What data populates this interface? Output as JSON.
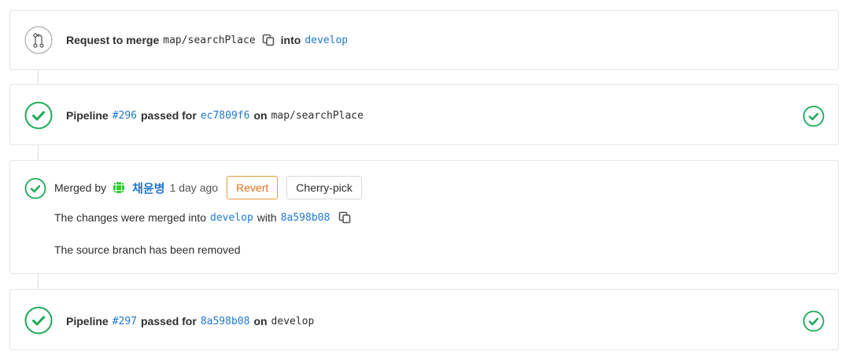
{
  "request_card": {
    "prefix": "Request to merge",
    "source_branch": "map/searchPlace",
    "into_label": "into",
    "target_branch": "develop"
  },
  "pipeline_1": {
    "label": "Pipeline",
    "id": "#296",
    "passed_for": "passed for",
    "commit": "ec7809f6",
    "on_label": "on",
    "branch": "map/searchPlace"
  },
  "merged_card": {
    "merged_by": "Merged by",
    "author": "채윤병",
    "time": "1 day ago",
    "revert_label": "Revert",
    "cherry_pick_label": "Cherry-pick",
    "changes_prefix": "The changes were merged into",
    "target_branch": "develop",
    "with_label": "with",
    "merge_commit": "8a598b08",
    "source_removed": "The source branch has been removed"
  },
  "pipeline_2": {
    "label": "Pipeline",
    "id": "#297",
    "passed_for": "passed for",
    "commit": "8a598b08",
    "on_label": "on",
    "branch": "develop"
  },
  "colors": {
    "success": "#1aaa55",
    "link": "#1f78d1",
    "revert": "#e0711c",
    "border": "#e5e5e5"
  },
  "icons": {
    "merge_request": "merge-request-icon",
    "status_success": "check-circle-icon",
    "copy": "copy-clipboard-icon",
    "avatar": "identicon-avatar"
  }
}
